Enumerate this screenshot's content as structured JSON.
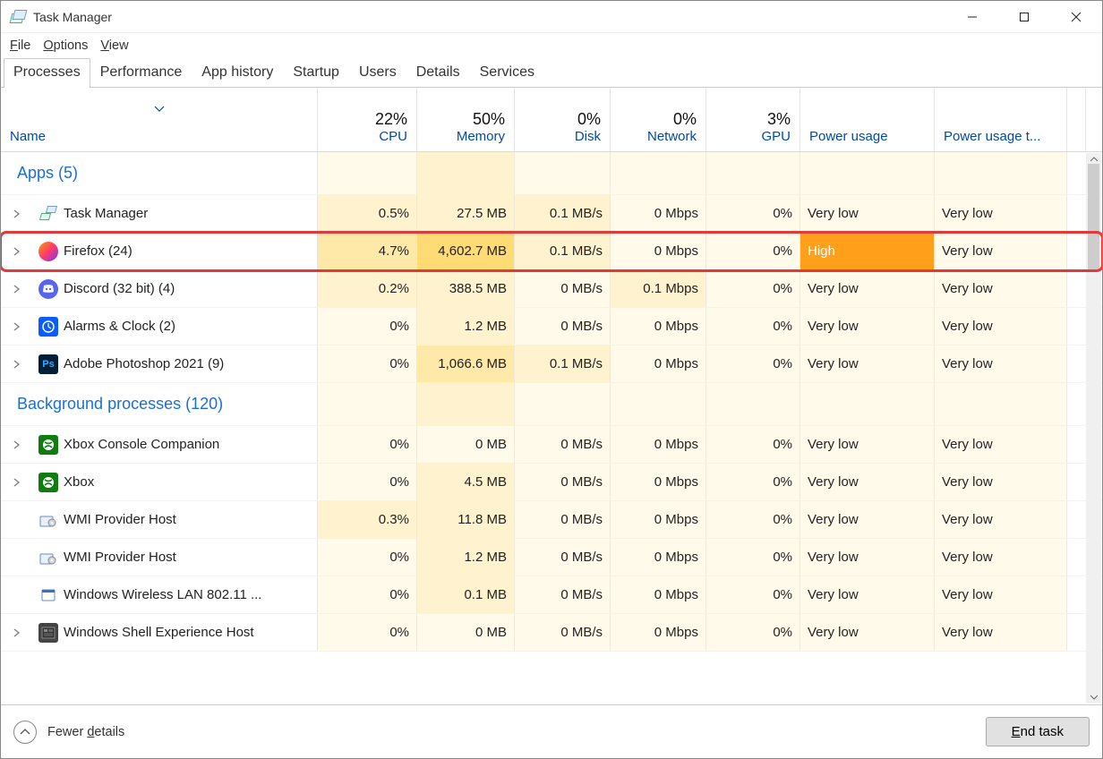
{
  "title": "Task Manager",
  "menu": [
    "File",
    "Options",
    "View"
  ],
  "tabs": [
    "Processes",
    "Performance",
    "App history",
    "Startup",
    "Users",
    "Details",
    "Services"
  ],
  "activeTab": 0,
  "columns": {
    "name": "Name",
    "cpu": {
      "pct": "22%",
      "label": "CPU"
    },
    "mem": {
      "pct": "50%",
      "label": "Memory"
    },
    "disk": {
      "pct": "0%",
      "label": "Disk"
    },
    "net": {
      "pct": "0%",
      "label": "Network"
    },
    "gpu": {
      "pct": "3%",
      "label": "GPU"
    },
    "power": "Power usage",
    "powert": "Power usage t..."
  },
  "groups": [
    {
      "label": "Apps (5)"
    },
    {
      "label": "Background processes (120)"
    }
  ],
  "rows": [
    {
      "group": 0,
      "expand": true,
      "icon": "tm",
      "name": "Task Manager",
      "cpu": "0.5%",
      "cpuBg": "bg1",
      "mem": "27.5 MB",
      "memBg": "bg1",
      "disk": "0.1 MB/s",
      "diskBg": "bg1",
      "net": "0 Mbps",
      "netBg": "bg0",
      "gpu": "0%",
      "gpuBg": "bg0",
      "power": "Very low",
      "powerBg": "bg0",
      "powert": "Very low",
      "powertBg": "bg0",
      "highlight": false
    },
    {
      "group": 0,
      "expand": true,
      "icon": "ff",
      "name": "Firefox (24)",
      "cpu": "4.7%",
      "cpuBg": "bg2",
      "mem": "4,602.7 MB",
      "memBg": "bg3",
      "disk": "0.1 MB/s",
      "diskBg": "bg1",
      "net": "0 Mbps",
      "netBg": "bg0",
      "gpu": "0%",
      "gpuBg": "bg0",
      "power": "High",
      "powerBg": "bgHigh",
      "powert": "Very low",
      "powertBg": "bg0",
      "highlight": true
    },
    {
      "group": 0,
      "expand": true,
      "icon": "dc",
      "name": "Discord (32 bit) (4)",
      "cpu": "0.2%",
      "cpuBg": "bg1",
      "mem": "388.5 MB",
      "memBg": "bg1",
      "disk": "0 MB/s",
      "diskBg": "bg0",
      "net": "0.1 Mbps",
      "netBg": "bg1",
      "gpu": "0%",
      "gpuBg": "bg0",
      "power": "Very low",
      "powerBg": "bg0",
      "powert": "Very low",
      "powertBg": "bg0",
      "highlight": false
    },
    {
      "group": 0,
      "expand": true,
      "icon": "ac",
      "name": "Alarms & Clock (2)",
      "cpu": "0%",
      "cpuBg": "bg0",
      "mem": "1.2 MB",
      "memBg": "bg1",
      "disk": "0 MB/s",
      "diskBg": "bg0",
      "net": "0 Mbps",
      "netBg": "bg0",
      "gpu": "0%",
      "gpuBg": "bg0",
      "power": "Very low",
      "powerBg": "bg0",
      "powert": "Very low",
      "powertBg": "bg0",
      "highlight": false
    },
    {
      "group": 0,
      "expand": true,
      "icon": "ps",
      "name": "Adobe Photoshop 2021 (9)",
      "cpu": "0%",
      "cpuBg": "bg0",
      "mem": "1,066.6 MB",
      "memBg": "bg2",
      "disk": "0.1 MB/s",
      "diskBg": "bg1",
      "net": "0 Mbps",
      "netBg": "bg0",
      "gpu": "0%",
      "gpuBg": "bg0",
      "power": "Very low",
      "powerBg": "bg0",
      "powert": "Very low",
      "powertBg": "bg0",
      "highlight": false
    },
    {
      "group": 1,
      "expand": true,
      "icon": "xb",
      "name": "Xbox Console Companion",
      "cpu": "0%",
      "cpuBg": "bg0",
      "mem": "0 MB",
      "memBg": "bg0",
      "disk": "0 MB/s",
      "diskBg": "bg0",
      "net": "0 Mbps",
      "netBg": "bg0",
      "gpu": "0%",
      "gpuBg": "bg0",
      "power": "Very low",
      "powerBg": "bg0",
      "powert": "Very low",
      "powertBg": "bg0",
      "highlight": false
    },
    {
      "group": 1,
      "expand": true,
      "icon": "xb",
      "name": "Xbox",
      "cpu": "0%",
      "cpuBg": "bg0",
      "mem": "4.5 MB",
      "memBg": "bg1",
      "disk": "0 MB/s",
      "diskBg": "bg0",
      "net": "0 Mbps",
      "netBg": "bg0",
      "gpu": "0%",
      "gpuBg": "bg0",
      "power": "Very low",
      "powerBg": "bg0",
      "powert": "Very low",
      "powertBg": "bg0",
      "highlight": false
    },
    {
      "group": 1,
      "expand": false,
      "icon": "wm",
      "name": "WMI Provider Host",
      "cpu": "0.3%",
      "cpuBg": "bg1",
      "mem": "11.8 MB",
      "memBg": "bg1",
      "disk": "0 MB/s",
      "diskBg": "bg0",
      "net": "0 Mbps",
      "netBg": "bg0",
      "gpu": "0%",
      "gpuBg": "bg0",
      "power": "Very low",
      "powerBg": "bg0",
      "powert": "Very low",
      "powertBg": "bg0",
      "highlight": false
    },
    {
      "group": 1,
      "expand": false,
      "icon": "wm",
      "name": "WMI Provider Host",
      "cpu": "0%",
      "cpuBg": "bg0",
      "mem": "1.2 MB",
      "memBg": "bg1",
      "disk": "0 MB/s",
      "diskBg": "bg0",
      "net": "0 Mbps",
      "netBg": "bg0",
      "gpu": "0%",
      "gpuBg": "bg0",
      "power": "Very low",
      "powerBg": "bg0",
      "powert": "Very low",
      "powertBg": "bg0",
      "highlight": false
    },
    {
      "group": 1,
      "expand": false,
      "icon": "wl",
      "name": "Windows Wireless LAN 802.11 ...",
      "cpu": "0%",
      "cpuBg": "bg0",
      "mem": "0.1 MB",
      "memBg": "bg1",
      "disk": "0 MB/s",
      "diskBg": "bg0",
      "net": "0 Mbps",
      "netBg": "bg0",
      "gpu": "0%",
      "gpuBg": "bg0",
      "power": "Very low",
      "powerBg": "bg0",
      "powert": "Very low",
      "powertBg": "bg0",
      "highlight": false
    },
    {
      "group": 1,
      "expand": true,
      "icon": "sh",
      "name": "Windows Shell Experience Host",
      "cpu": "0%",
      "cpuBg": "bg0",
      "mem": "0 MB",
      "memBg": "bg0",
      "disk": "0 MB/s",
      "diskBg": "bg0",
      "net": "0 Mbps",
      "netBg": "bg0",
      "gpu": "0%",
      "gpuBg": "bg0",
      "power": "Very low",
      "powerBg": "bg0",
      "powert": "Very low",
      "powertBg": "bg0",
      "highlight": false
    }
  ],
  "footer": {
    "fewer": "Fewer details",
    "end": "End task"
  },
  "icons": {
    "tm": {
      "bg": "#fff",
      "txt": "",
      "svg": true
    },
    "ff": {
      "bg": "linear-gradient(135deg,#ff9a00,#ff3b6b,#7b2ff7)",
      "txt": ""
    },
    "dc": {
      "bg": "#5865F2",
      "txt": ""
    },
    "ac": {
      "bg": "#0b5cff",
      "txt": ""
    },
    "ps": {
      "bg": "#001e36",
      "txt": "Ps",
      "color": "#31a8ff"
    },
    "xb": {
      "bg": "#107c10",
      "txt": ""
    },
    "wm": {
      "bg": "#fff",
      "txt": "",
      "gear": true
    },
    "wl": {
      "bg": "#fff",
      "txt": "",
      "win": true
    },
    "sh": {
      "bg": "#444",
      "txt": ""
    }
  }
}
